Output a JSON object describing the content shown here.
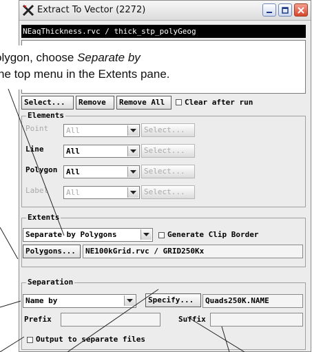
{
  "window": {
    "title": "Extract To Vector (2272)",
    "object_path": "NEaqThickness.rvc / thick_stp_polyGeog"
  },
  "callout": {
    "line1_pre": "olygon, choose ",
    "line1_em": "Separate by",
    "line2": "he top menu in the Extents pane."
  },
  "toolbar": {
    "select_label": "Select...",
    "remove_label": "Remove",
    "remove_all_label": "Remove All",
    "clear_after_run_label": "Clear after run"
  },
  "elements": {
    "legend": "Elements",
    "rows": [
      {
        "label": "Point",
        "value": "All",
        "select": "Select...",
        "enabled": false
      },
      {
        "label": "Line",
        "value": "All",
        "select": "Select...",
        "enabled": true
      },
      {
        "label": "Polygon",
        "value": "All",
        "select": "Select...",
        "enabled": true
      },
      {
        "label": "Label",
        "value": "All",
        "select": "Select...",
        "enabled": false
      }
    ]
  },
  "extents": {
    "legend": "Extents",
    "mode": "Separate by Polygons",
    "clip_border_label": "Generate Clip Border",
    "polygons_button": "Polygons...",
    "polygons_path": "NE100kGrid.rvc / GRID250Kx"
  },
  "separation": {
    "legend": "Separation",
    "name_by": "Name by",
    "specify_button": "Specify...",
    "specify_value": "Quads250K.NAME",
    "prefix_label": "Prefix",
    "prefix_value": "",
    "suffix_label": "Suffix",
    "suffix_value": "",
    "output_separate_label": "Output to separate files"
  },
  "colors": {
    "window_bg": "#ececec",
    "object_field_bg": "#000000",
    "close_button": "#d8452a"
  }
}
